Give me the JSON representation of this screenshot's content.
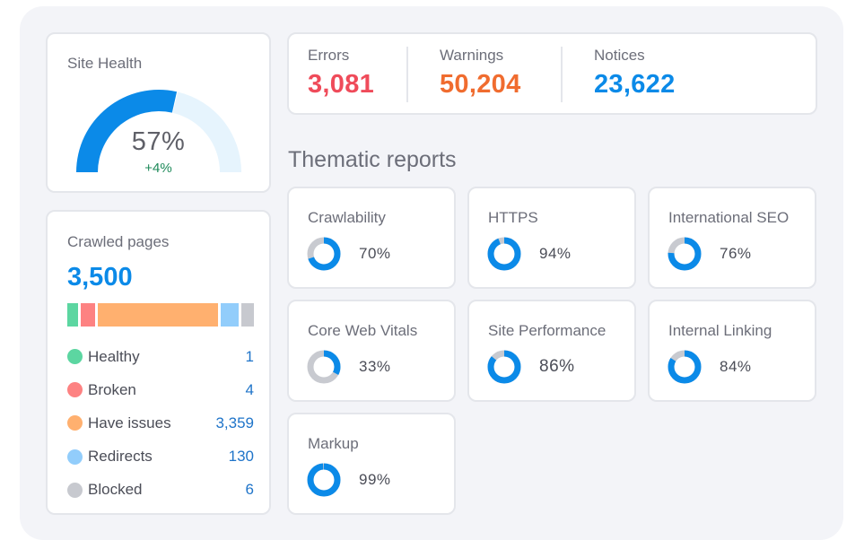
{
  "colors": {
    "accent_blue": "#0b8ae8",
    "gauge_track": "#e6f4fd",
    "donut_track": "#c8cad0",
    "errors": "#ef4b5a",
    "warnings": "#f06c2f",
    "notices": "#0b8ae8"
  },
  "site_health": {
    "title": "Site Health",
    "value": "57%",
    "value_fraction": 0.57,
    "delta": "+4%"
  },
  "issues": [
    {
      "label": "Errors",
      "value": "3,081",
      "color": "#ef4b5a"
    },
    {
      "label": "Warnings",
      "value": "50,204",
      "color": "#f06c2f"
    },
    {
      "label": "Notices",
      "value": "23,622",
      "color": "#0b8ae8"
    }
  ],
  "crawled_pages": {
    "title": "Crawled pages",
    "total": "3,500",
    "bar_weights": [
      0.06,
      0.08,
      0.66,
      0.1,
      0.07
    ],
    "items": [
      {
        "label": "Healthy",
        "value": "1",
        "color": "#5cd6a1"
      },
      {
        "label": "Broken",
        "value": "4",
        "color": "#fd8282"
      },
      {
        "label": "Have issues",
        "value": "3,359",
        "color": "#ffb06f"
      },
      {
        "label": "Redirects",
        "value": "130",
        "color": "#92cdfb"
      },
      {
        "label": "Blocked",
        "value": "6",
        "color": "#c7c9cf"
      }
    ]
  },
  "thematic": {
    "title": "Thematic reports",
    "reports": [
      {
        "name": "Crawlability",
        "value": "70%",
        "percent": 70
      },
      {
        "name": "HTTPS",
        "value": "94%",
        "percent": 94
      },
      {
        "name": "International SEO",
        "value": "76%",
        "percent": 76
      },
      {
        "name": "Core Web Vitals",
        "value": "33%",
        "percent": 33
      },
      {
        "name": "Site Performance",
        "value": "86%",
        "percent": 86
      },
      {
        "name": "Internal Linking",
        "value": "84%",
        "percent": 84
      },
      {
        "name": "Markup",
        "value": "99%",
        "percent": 99
      }
    ]
  }
}
